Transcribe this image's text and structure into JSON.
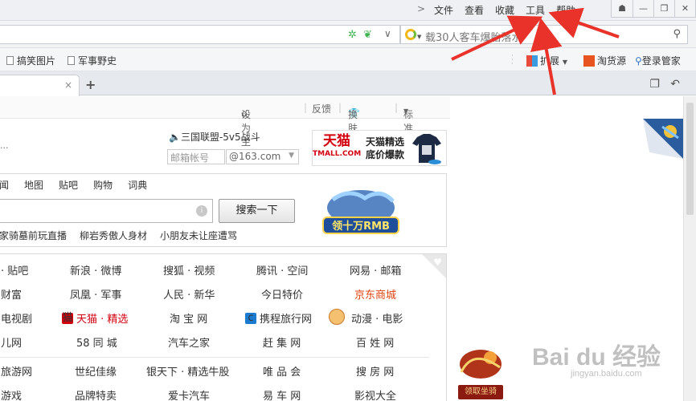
{
  "titlebar": {
    "chevron": ">",
    "menu": [
      "文件",
      "查看",
      "收藏",
      "工具",
      "帮助"
    ],
    "controls": {
      "skin": "☗",
      "minimize": "—",
      "maximize": "❐",
      "close": "✕"
    }
  },
  "addressbar": {
    "search_placeholder": "载30人客车爆胎落水",
    "dropdown": "∨"
  },
  "bookmarks": {
    "items": [
      "搞笑图片",
      "军事野史"
    ],
    "right": {
      "extensions": "扩展",
      "taohuoyuan": "淘货源",
      "login": "登录管家"
    }
  },
  "tabs": {
    "close": "×",
    "new": "+"
  },
  "page": {
    "toplinks": {
      "set_home": "设为主页",
      "feedback": "反馈",
      "skin": "换肤",
      "version": "标准版"
    },
    "announce": "三国联盟-5v5战斗",
    "dots": "...",
    "mail": {
      "account_placeholder": "邮箱帐号",
      "domain": "@163.com"
    },
    "tmall_ad": {
      "brand": "天猫",
      "brand_en": "TMALL.COM",
      "line1": "天猫精选",
      "line2": "底价爆款"
    },
    "search": {
      "tabs": [
        "闻",
        "地图",
        "贴吧",
        "购物",
        "词典"
      ],
      "button": "搜索一下",
      "hot": [
        "家骑墓前玩直播",
        "柳岩秀傲人身材",
        "小朋友未让座遭骂"
      ]
    },
    "game_ad_label": "领十万RMB",
    "sites": [
      [
        "· 贴吧",
        "新浪 · 微博",
        "搜狐 · 视频",
        "腾讯 · 空间",
        "网易 · 邮箱"
      ],
      [
        "财富",
        "凤凰 · 军事",
        "人民 · 新华",
        "今日特价",
        "京东商城"
      ],
      [
        "电视剧",
        "天猫 · 精选",
        "淘 宝 网",
        "携程旅行网",
        "动漫 · 电影"
      ],
      [
        "儿网",
        "58 同 城",
        "汽车之家",
        "赶 集 网",
        "百 姓 网"
      ],
      [
        "旅游网",
        "世纪佳缘",
        "银天下 · 精选牛股",
        "唯 品 会",
        "搜 房 网"
      ],
      [
        "游戏",
        "品牌特卖",
        "爱卡汽车",
        "易 车 网",
        "影视大全"
      ]
    ],
    "right_game_label": "领取坐骑",
    "watermark": {
      "main": "Bai du 经验",
      "sub": "jingyan.baidu.com"
    }
  }
}
